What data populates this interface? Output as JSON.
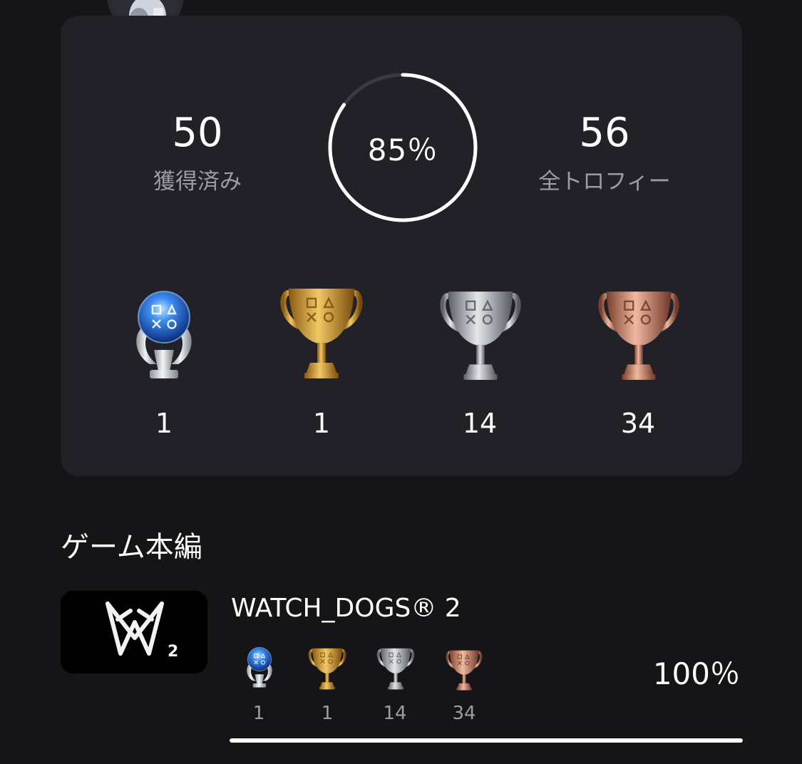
{
  "summary": {
    "earned_count": "50",
    "earned_label": "獲得済み",
    "progress_text": "85％",
    "progress_value": 0.85,
    "total_count": "56",
    "total_label": "全トロフィー",
    "trophies": [
      {
        "type": "platinum",
        "icon": "platinum-trophy-icon",
        "count": "1"
      },
      {
        "type": "gold",
        "icon": "gold-trophy-icon",
        "count": "1"
      },
      {
        "type": "silver",
        "icon": "silver-trophy-icon",
        "count": "14"
      },
      {
        "type": "bronze",
        "icon": "bronze-trophy-icon",
        "count": "34"
      }
    ]
  },
  "section": {
    "title": "ゲーム本編"
  },
  "game": {
    "title": "WATCH_DOGS® 2",
    "progress_text": "100％",
    "progress_value": 1.0,
    "trophies": [
      {
        "type": "platinum",
        "count": "1"
      },
      {
        "type": "gold",
        "count": "1"
      },
      {
        "type": "silver",
        "count": "14"
      },
      {
        "type": "bronze",
        "count": "34"
      }
    ]
  },
  "colors": {
    "background": "#151517",
    "card": "#222127",
    "label_gray": "#9c9ca3",
    "accent_white": "#ffffff"
  }
}
